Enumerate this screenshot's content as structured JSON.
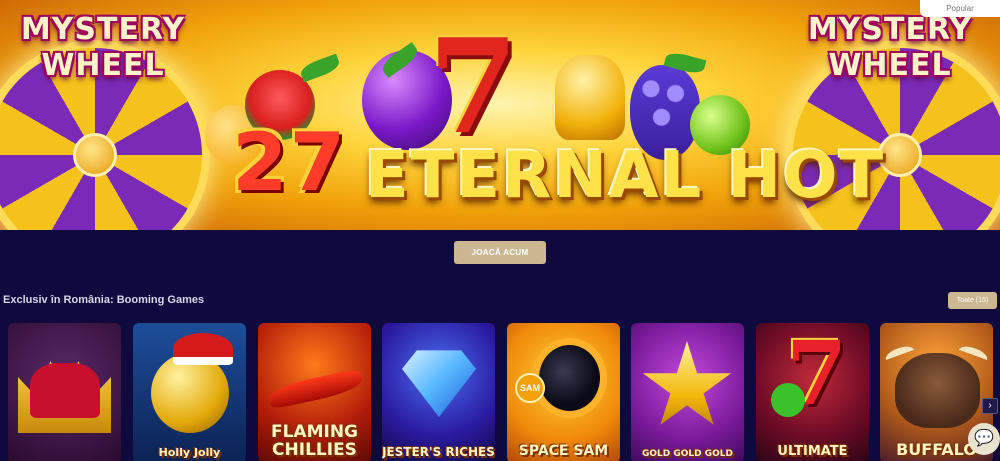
{
  "banner": {
    "wheel_title_line1": "MYSTERY",
    "wheel_title_line2": "WHEEL",
    "number": "27",
    "title": "ETERNAL HOT",
    "seven": "7",
    "badge": "Popular"
  },
  "cta": {
    "label": "JOACĂ ACUM"
  },
  "section": {
    "title": "Exclusiv în România: Booming Games",
    "all_label": "Toate (15)"
  },
  "games": [
    {
      "name": ""
    },
    {
      "name": "Holly Jolly"
    },
    {
      "name": "FLAMING CHILLIES"
    },
    {
      "name": "JESTER'S RICHES"
    },
    {
      "name": "SPACE SAM",
      "badge": "SAM"
    },
    {
      "name": "GOLD GOLD GOLD"
    },
    {
      "name": "ULTIMATE"
    },
    {
      "name": "BUFFALO"
    }
  ],
  "controls": {
    "next_icon": "›",
    "chat_icon": "chat-bubble-icon"
  },
  "colors": {
    "background": "#0f0a3d",
    "accent_button": "#cdb792"
  }
}
